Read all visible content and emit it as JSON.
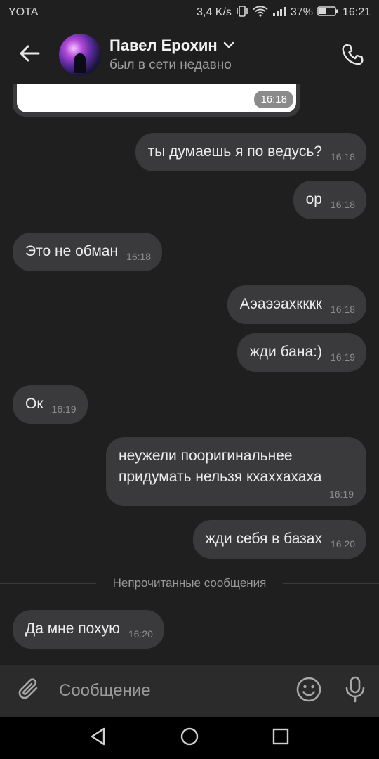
{
  "status_bar": {
    "carrier": "YOTA",
    "speed": "3,4 K/s",
    "battery": "37%",
    "time": "16:21"
  },
  "header": {
    "contact_name": "Павел Ерохин",
    "contact_status": "был в сети недавно"
  },
  "chat": {
    "media_time": "16:18",
    "messages": [
      {
        "direction": "out",
        "text": "ты думаешь я по ведусь?",
        "time": "16:18"
      },
      {
        "direction": "out",
        "text": "ор",
        "time": "16:18"
      },
      {
        "direction": "in",
        "text": "Это не обман",
        "time": "16:18"
      },
      {
        "direction": "out",
        "text": "Аэаээахкккк",
        "time": "16:18"
      },
      {
        "direction": "out",
        "text": "жди бана:)",
        "time": "16:19"
      },
      {
        "direction": "in",
        "text": "Ок",
        "time": "16:19"
      },
      {
        "direction": "out",
        "lines": [
          "неужели пооригинальнее",
          "придумать нельзя кхаххахаха"
        ],
        "time": "16:19"
      },
      {
        "direction": "out",
        "text": "жди себя в базах",
        "time": "16:20"
      },
      {
        "direction": "in",
        "text": "Да мне похую",
        "time": "16:20"
      }
    ],
    "unread_divider": "Непрочитанные сообщения"
  },
  "input": {
    "placeholder": "Сообщение"
  },
  "icons": {
    "back": "arrow-left-icon",
    "call": "phone-icon",
    "attach": "paperclip-icon",
    "emoji": "smiley-icon",
    "mic": "microphone-icon"
  },
  "colors": {
    "background": "#1f1f1f",
    "bubble": "#3a3a3c",
    "input_bar": "#2b2b2b"
  }
}
